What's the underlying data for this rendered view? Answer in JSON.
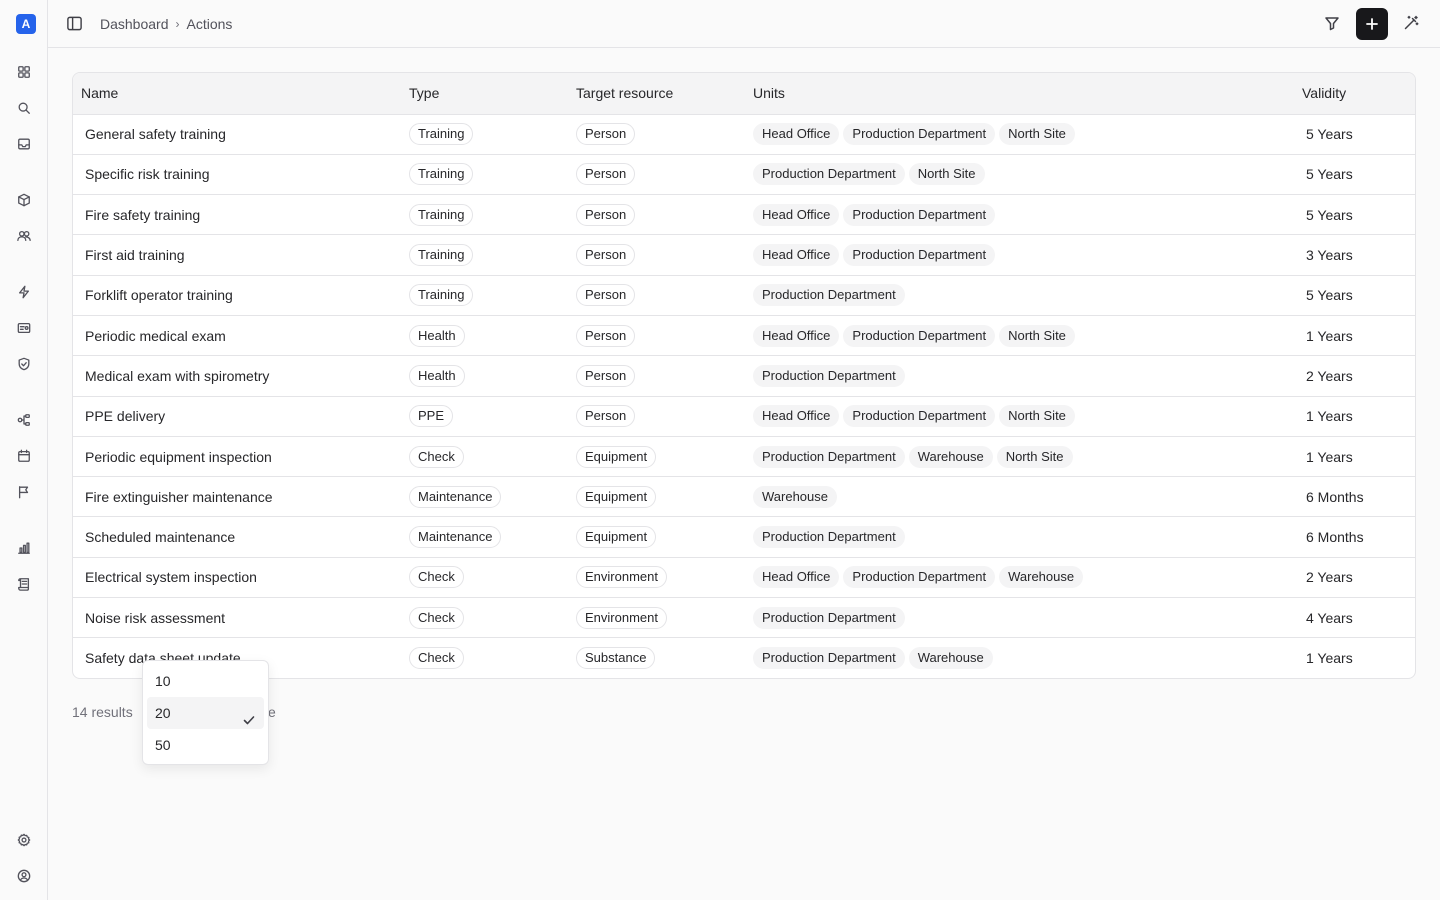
{
  "app": {
    "logo_letter": "A"
  },
  "sidebar": {
    "items": [
      {
        "icon": "grid-icon"
      },
      {
        "icon": "search-icon"
      },
      {
        "icon": "inbox-icon"
      },
      {
        "icon": "box-icon"
      },
      {
        "icon": "users-icon"
      },
      {
        "icon": "bolt-icon"
      },
      {
        "icon": "id-card-icon"
      },
      {
        "icon": "shield-icon"
      },
      {
        "icon": "workflow-icon"
      },
      {
        "icon": "calendar-icon"
      },
      {
        "icon": "flag-icon"
      },
      {
        "icon": "chart-icon"
      },
      {
        "icon": "scroll-icon"
      },
      {
        "icon": "settings-icon"
      },
      {
        "icon": "user-circle-icon"
      }
    ]
  },
  "breadcrumb": {
    "items": [
      "Dashboard",
      "Actions"
    ]
  },
  "table": {
    "columns": [
      "Name",
      "Type",
      "Target resource",
      "Units",
      "Validity"
    ],
    "rows": [
      {
        "name": "General safety training",
        "type": "Training",
        "target": "Person",
        "units": [
          "Head Office",
          "Production Department",
          "North Site"
        ],
        "validity": "5 Years"
      },
      {
        "name": "Specific risk training",
        "type": "Training",
        "target": "Person",
        "units": [
          "Production Department",
          "North Site"
        ],
        "validity": "5 Years"
      },
      {
        "name": "Fire safety training",
        "type": "Training",
        "target": "Person",
        "units": [
          "Head Office",
          "Production Department"
        ],
        "validity": "5 Years"
      },
      {
        "name": "First aid training",
        "type": "Training",
        "target": "Person",
        "units": [
          "Head Office",
          "Production Department"
        ],
        "validity": "3 Years"
      },
      {
        "name": "Forklift operator training",
        "type": "Training",
        "target": "Person",
        "units": [
          "Production Department"
        ],
        "validity": "5 Years"
      },
      {
        "name": "Periodic medical exam",
        "type": "Health",
        "target": "Person",
        "units": [
          "Head Office",
          "Production Department",
          "North Site"
        ],
        "validity": "1 Years"
      },
      {
        "name": "Medical exam with spirometry",
        "type": "Health",
        "target": "Person",
        "units": [
          "Production Department"
        ],
        "validity": "2 Years"
      },
      {
        "name": "PPE delivery",
        "type": "PPE",
        "target": "Person",
        "units": [
          "Head Office",
          "Production Department",
          "North Site"
        ],
        "validity": "1 Years"
      },
      {
        "name": "Periodic equipment inspection",
        "type": "Check",
        "target": "Equipment",
        "units": [
          "Production Department",
          "Warehouse",
          "North Site"
        ],
        "validity": "1 Years"
      },
      {
        "name": "Fire extinguisher maintenance",
        "type": "Maintenance",
        "target": "Equipment",
        "units": [
          "Warehouse"
        ],
        "validity": "6 Months"
      },
      {
        "name": "Scheduled maintenance",
        "type": "Maintenance",
        "target": "Equipment",
        "units": [
          "Production Department"
        ],
        "validity": "6 Months"
      },
      {
        "name": "Electrical system inspection",
        "type": "Check",
        "target": "Environment",
        "units": [
          "Head Office",
          "Production Department",
          "Warehouse"
        ],
        "validity": "2 Years"
      },
      {
        "name": "Noise risk assessment",
        "type": "Check",
        "target": "Environment",
        "units": [
          "Production Department"
        ],
        "validity": "4 Years"
      },
      {
        "name": "Safety data sheet update",
        "type": "Check",
        "target": "Substance",
        "units": [
          "Production Department",
          "Warehouse"
        ],
        "validity": "1 Years"
      }
    ]
  },
  "footer": {
    "results_text": "14 results",
    "trailing_text": "e"
  },
  "page_size_dropdown": {
    "options": [
      "10",
      "20",
      "50"
    ],
    "selected": "20"
  },
  "colors": {
    "accent": "#2563eb",
    "primary_button": "#18181b"
  }
}
